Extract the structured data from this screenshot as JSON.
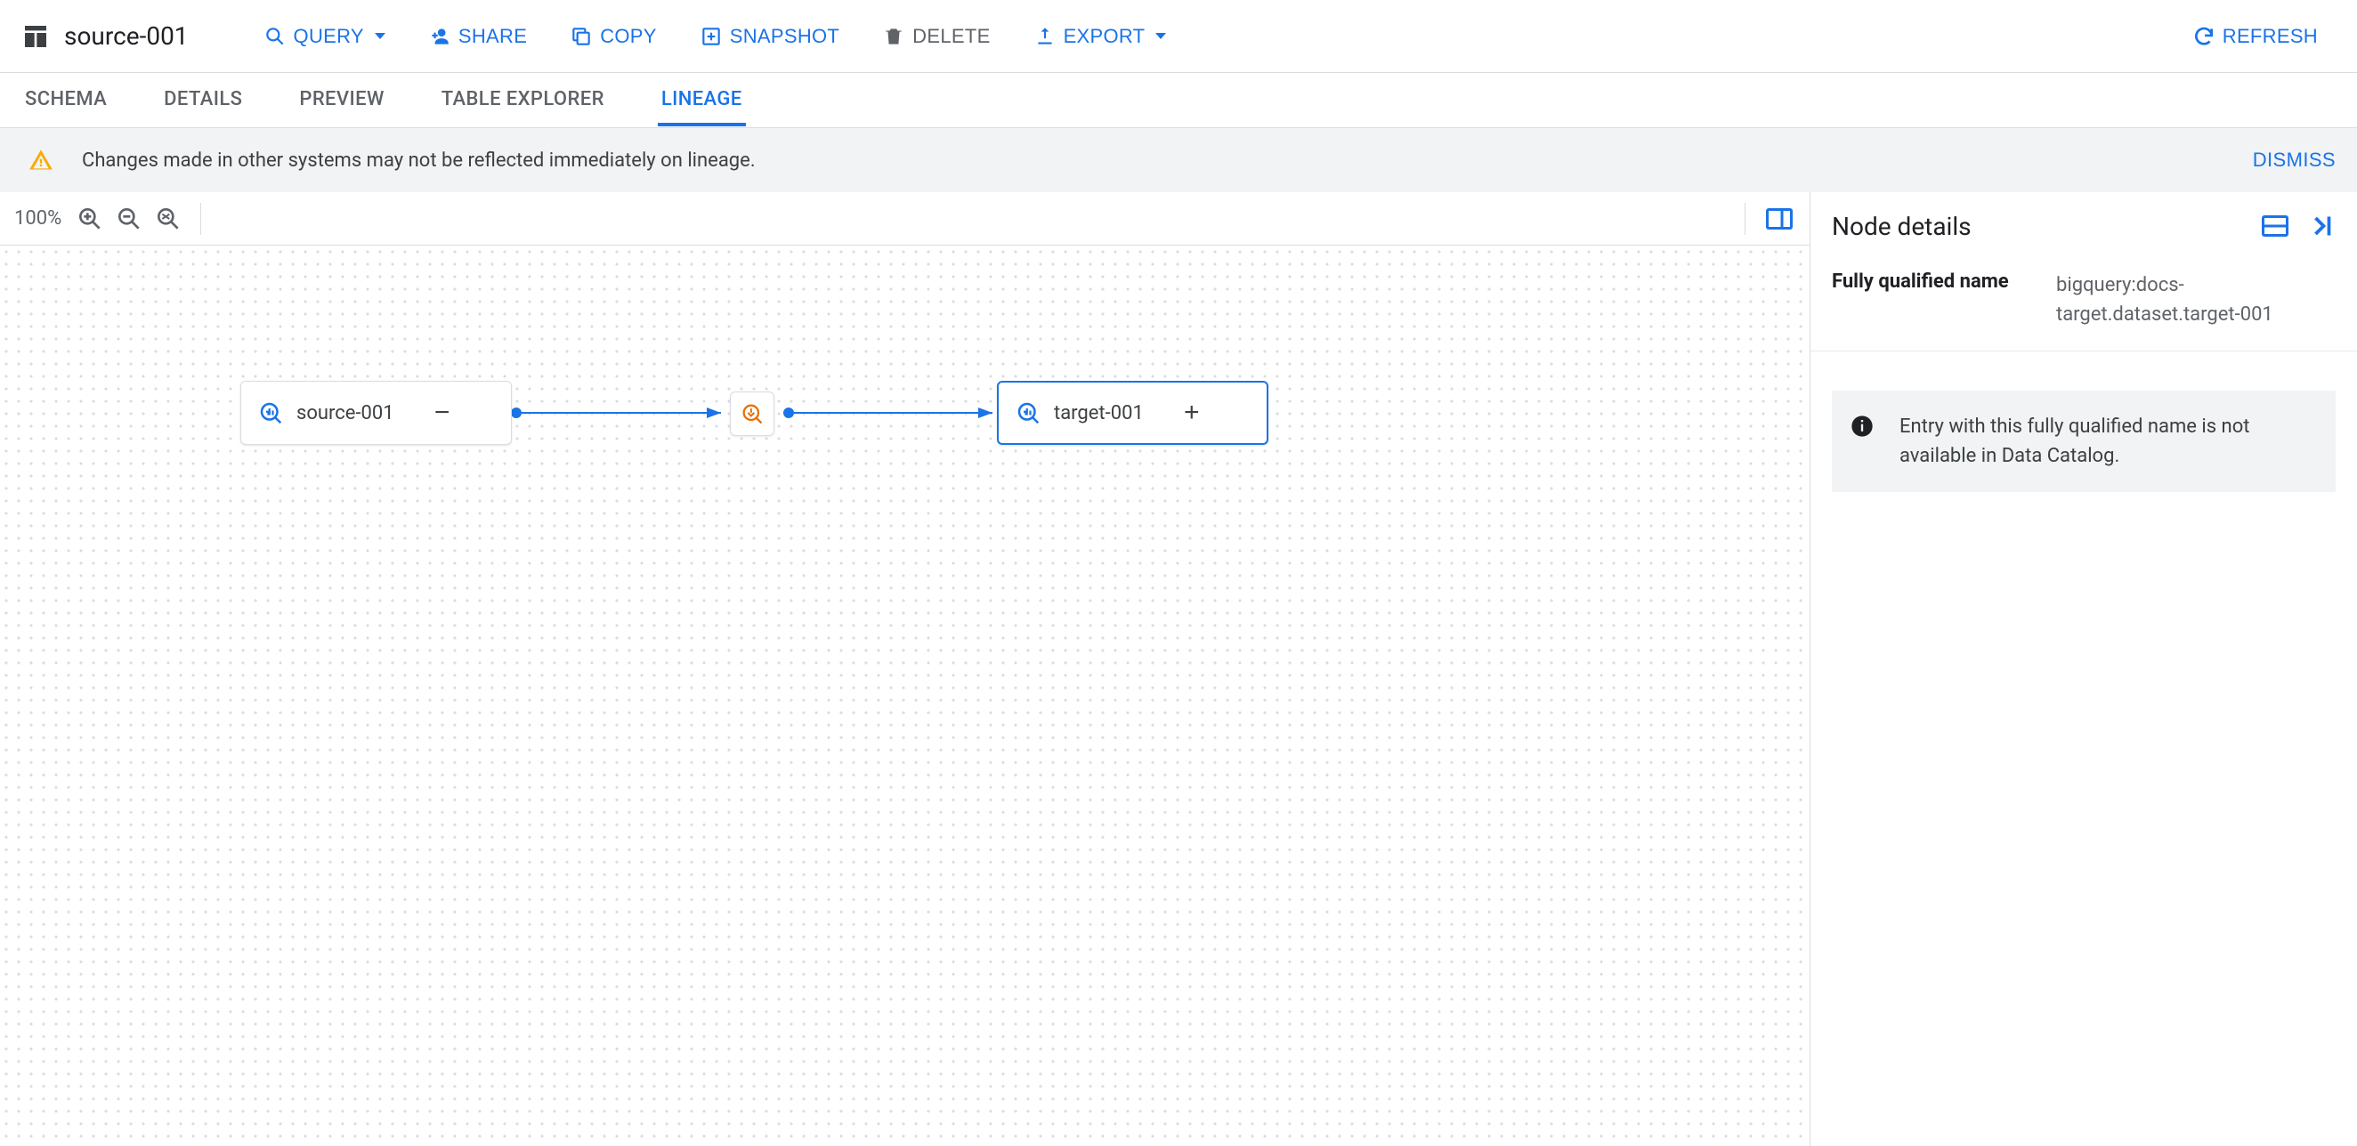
{
  "toolbar": {
    "title": "source-001",
    "query": "QUERY",
    "share": "SHARE",
    "copy": "COPY",
    "snapshot": "SNAPSHOT",
    "delete": "DELETE",
    "export": "EXPORT",
    "refresh": "REFRESH"
  },
  "tabs": {
    "schema": "SCHEMA",
    "details": "DETAILS",
    "preview": "PREVIEW",
    "table_explorer": "TABLE EXPLORER",
    "lineage": "LINEAGE",
    "active": "lineage"
  },
  "banner": {
    "message": "Changes made in other systems may not be reflected immediately on lineage.",
    "dismiss": "DISMISS"
  },
  "graph": {
    "zoom": "100%",
    "nodes": {
      "source": {
        "label": "source-001",
        "action": "minus"
      },
      "target": {
        "label": "target-001",
        "action": "plus",
        "selected": true
      }
    }
  },
  "details": {
    "heading": "Node details",
    "fqn_label": "Fully qualified name",
    "fqn_value": "bigquery:docs-target.dataset.target-001",
    "note": "Entry with this fully qualified name is not available in Data Catalog."
  }
}
